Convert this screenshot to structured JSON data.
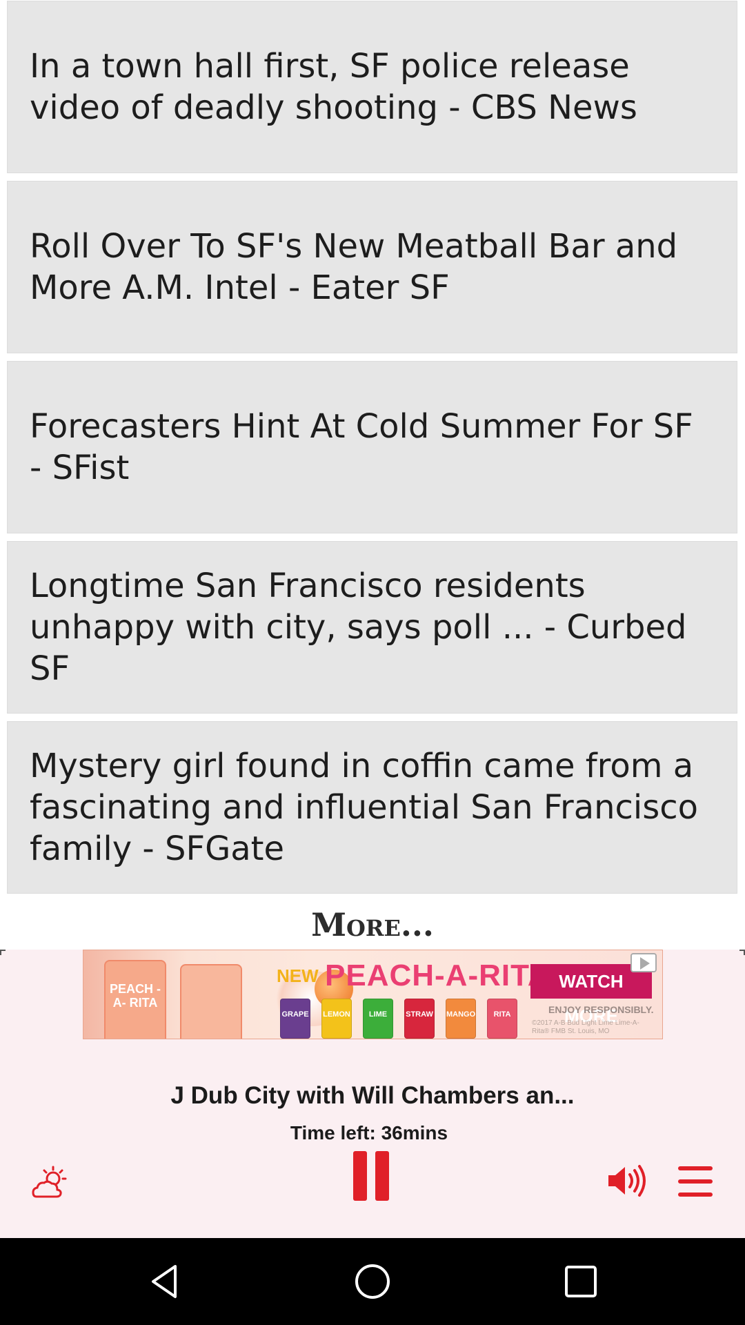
{
  "news": {
    "items": [
      {
        "headline": "In a town hall first, SF police release video of deadly shooting - CBS News"
      },
      {
        "headline": "Roll Over To SF's New Meatball Bar and More A.M. Intel - Eater SF"
      },
      {
        "headline": "Forecasters Hint At Cold Summer For SF - SFist"
      },
      {
        "headline": "Longtime San Francisco residents unhappy with city, says poll ... - Curbed SF"
      },
      {
        "headline": "Mystery girl found in coffin came from a fascinating and influential San Francisco family - SFGate"
      }
    ],
    "more_label": "More..."
  },
  "ad": {
    "new_label": "NEW",
    "headline": "PEACH-A-RITA",
    "cta_label": "WATCH MORE",
    "disclaimer": "ENJOY RESPONSIBLY.",
    "fine_print": "©2017 A-B Bud Light Lime Lime-A-Rita® FMB St. Louis, MO",
    "can_label": "PEACH -A- RITA",
    "flavors": [
      "GRAPE",
      "LEMON",
      "LIME",
      "STRAW",
      "MANGO",
      "RITA"
    ],
    "colors": {
      "accent_pink": "#ea3f72",
      "cta_bg": "#c8185c"
    }
  },
  "player": {
    "show_title": "J Dub City with Will Chambers an...",
    "time_left": "Time left: 36mins",
    "controls": {
      "weather_icon": "weather-icon",
      "pause_icon": "pause-icon",
      "volume_icon": "volume-icon",
      "menu_icon": "menu-icon"
    },
    "accent_color": "#e02028"
  },
  "system_nav": {
    "back_icon": "back-icon",
    "home_icon": "home-icon",
    "recents_icon": "recents-icon"
  }
}
